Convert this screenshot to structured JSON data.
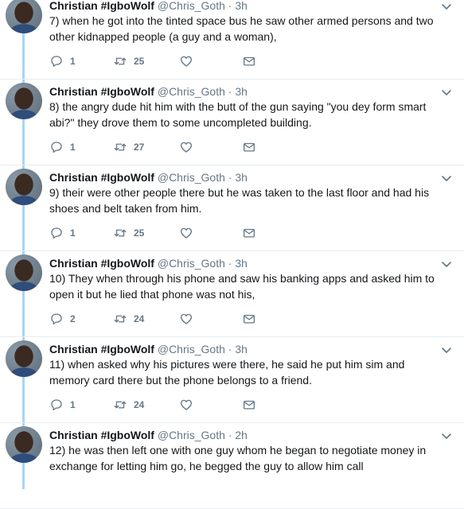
{
  "icons": {
    "reply": "reply-icon",
    "retweet": "retweet-icon",
    "like": "heart-icon",
    "dm": "envelope-icon",
    "menu": "chevron-down-icon"
  },
  "colors": {
    "thread_line": "#a8d4f5",
    "meta": "#657786",
    "text": "#14171a"
  },
  "tweets": [
    {
      "name": "Christian #IgboWolf",
      "handle": "@Chris_Goth",
      "sep": "·",
      "time": "3h",
      "text": "7) when he got into the tinted space bus he saw other armed persons and two other kidnapped people (a guy and a woman),",
      "replies": "1",
      "retweets": "25"
    },
    {
      "name": "Christian #IgboWolf",
      "handle": "@Chris_Goth",
      "sep": "·",
      "time": "3h",
      "text": "8) the angry dude hit him with the butt of the gun saying \"you dey form smart abi?\"   they drove them to some uncompleted building.",
      "replies": "1",
      "retweets": "27"
    },
    {
      "name": "Christian #IgboWolf",
      "handle": "@Chris_Goth",
      "sep": "·",
      "time": "3h",
      "text": "9) their were other people there but he was taken to the last floor and had his shoes and belt taken from him.",
      "replies": "1",
      "retweets": "25"
    },
    {
      "name": "Christian #IgboWolf",
      "handle": "@Chris_Goth",
      "sep": "·",
      "time": "3h",
      "text": "10) They when through his phone and saw his banking apps and asked him to open it but he lied that phone was not his,",
      "replies": "2",
      "retweets": "24"
    },
    {
      "name": "Christian #IgboWolf",
      "handle": "@Chris_Goth",
      "sep": "·",
      "time": "3h",
      "text": "11) when asked why his pictures were there, he said he put him sim and memory card there but the phone belongs to a friend.",
      "replies": "1",
      "retweets": "24"
    },
    {
      "name": "Christian #IgboWolf",
      "handle": "@Chris_Goth",
      "sep": "·",
      "time": "2h",
      "text": "12) he was then left one with one guy whom he began to negotiate money in exchange for letting him go, he begged the guy to allow him call"
    }
  ]
}
